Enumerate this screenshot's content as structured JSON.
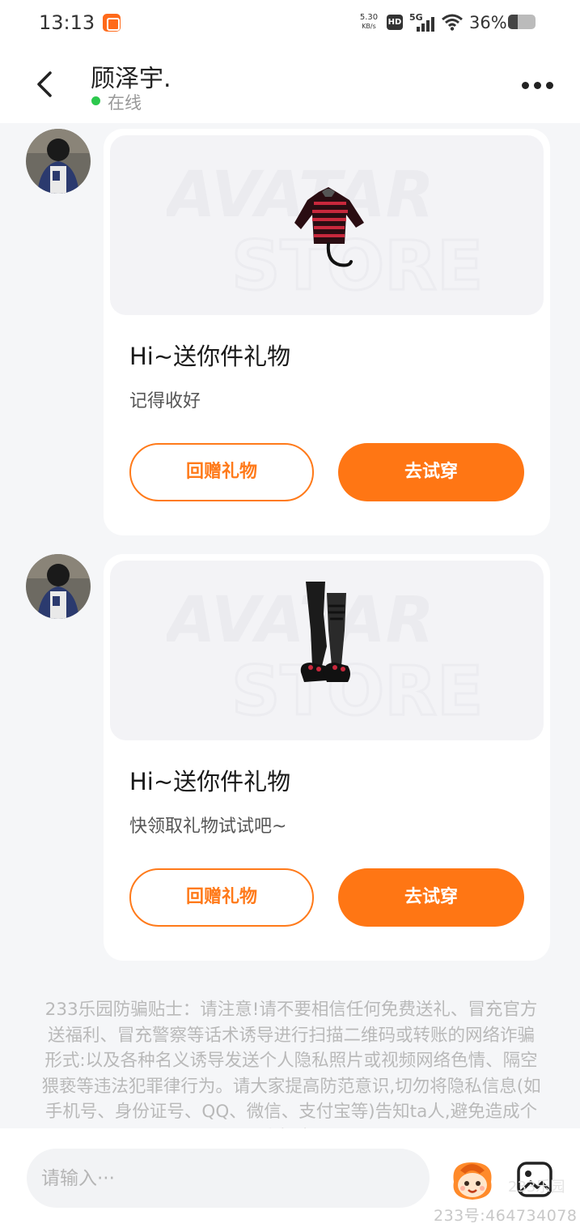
{
  "status_bar": {
    "time": "13:13",
    "net_speed": "5.30",
    "net_unit": "KB/s",
    "hd": "HD",
    "network": "5G",
    "battery_text": "36%",
    "battery_level": 0.36
  },
  "header": {
    "contact_name": "顾泽宇.",
    "status": "在线",
    "status_color": "#2cc84d"
  },
  "messages": [
    {
      "title": "Hi~送你件礼物",
      "subtitle": "记得收好",
      "item_icon": "red-black-striped-hoodie",
      "watermark": [
        "AVATAR",
        "STORE"
      ],
      "return_gift_label": "回赠礼物",
      "try_on_label": "去试穿"
    },
    {
      "title": "Hi~送你件礼物",
      "subtitle": "快领取礼物试试吧~",
      "item_icon": "black-leggings-and-shoes",
      "watermark": [
        "AVATAR",
        "STORE"
      ],
      "return_gift_label": "回赠礼物",
      "try_on_label": "去试穿"
    }
  ],
  "notice": "233乐园防骗贴士：请注意!请不要相信任何免费送礼、冒充官方送福利、冒充警察等话术诱导进行扫描二维码或转账的网络诈骗形式:以及各种名义诱导发送个人隐私照片或视频网络色情、隔空猥亵等违法犯罪律行为。请大家提高防范意识,切勿将隐私信息(如手机号、身份证号、QQ、微信、支付宝等)告知ta人,避免造成个人损失!",
  "input": {
    "placeholder": "请输入···"
  },
  "watermark": {
    "brand": "233乐园",
    "user_id": "233号:464734078"
  },
  "colors": {
    "accent": "#ff7614",
    "background": "#f5f6f8"
  }
}
